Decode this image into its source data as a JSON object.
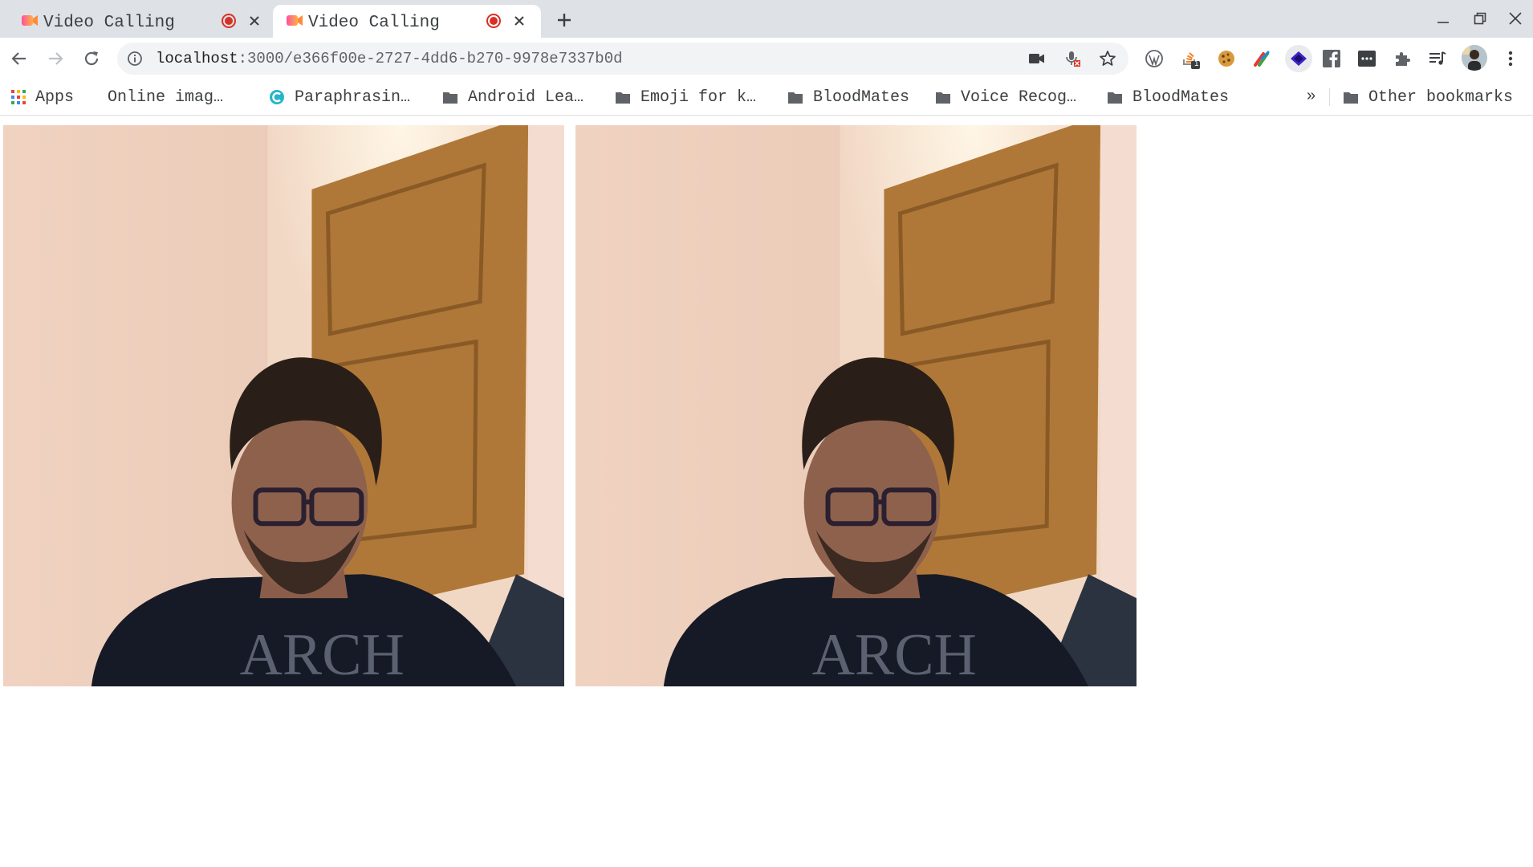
{
  "tabs": [
    {
      "title": "Video Calling",
      "favicon": "video-calling-favicon",
      "recording": true,
      "active": false
    },
    {
      "title": "Video Calling",
      "favicon": "video-calling-favicon",
      "recording": true,
      "active": true
    }
  ],
  "address_bar": {
    "host": "localhost",
    "path": ":3000/e366f00e-2727-4dd6-b270-9978e7337b0d"
  },
  "extensions": {
    "badge_count": "1"
  },
  "bookmarks": {
    "apps_label": "Apps",
    "items": [
      {
        "label": "Online imag…",
        "icon": "blank-page-icon"
      },
      {
        "label": "Paraphrasin…",
        "icon": "paraphrasing-site-icon"
      },
      {
        "label": "Android Lea…",
        "icon": "folder-icon"
      },
      {
        "label": "Emoji for k…",
        "icon": "folder-icon"
      },
      {
        "label": "BloodMates",
        "icon": "folder-icon"
      },
      {
        "label": "Voice Recog…",
        "icon": "folder-icon"
      },
      {
        "label": "BloodMates",
        "icon": "folder-icon"
      }
    ],
    "overflow_label": "»",
    "other_label": "Other bookmarks"
  },
  "videos": [
    {
      "label": "local-video"
    },
    {
      "label": "remote-video"
    }
  ],
  "colors": {
    "tabstrip": "#dee1e6",
    "omnibox": "#f1f3f4",
    "recording": "#d93025",
    "wall": "#e8cdbd",
    "door": "#b07838"
  }
}
